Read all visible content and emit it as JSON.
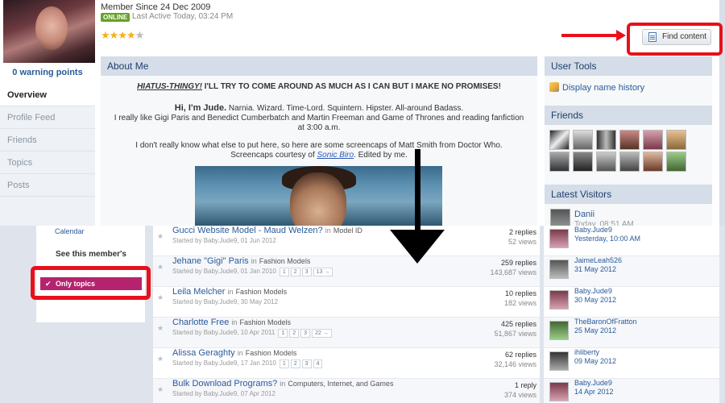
{
  "profile": {
    "member_since": "Member Since 24 Dec 2009",
    "online_badge": "ONLINE",
    "last_active": "Last Active Today, 03:24 PM",
    "warning_points": "0 warning points",
    "rating_stars": 4,
    "find_content_label": "Find content"
  },
  "nav": {
    "items": [
      "Overview",
      "Profile Feed",
      "Friends",
      "Topics",
      "Posts"
    ]
  },
  "about": {
    "title": "About Me",
    "hiatus_link": "HIATUS-THINGY!",
    "hiatus_text": " I'LL TRY TO COME AROUND AS MUCH AS I CAN BUT I MAKE NO PROMISES!",
    "hi_heading": "Hi, I'm Jude.",
    "hi_text": " Narnia. Wizard. Time-Lord. Squintern. Hipster. All-around Badass.",
    "paragraph_1": "I really like Gigi Paris and Benedict Cumberbatch and Martin Freeman and Game of Thrones and reading fanfiction at 3:00 a.m.",
    "paragraph_2": "I don't really know what else to put here, so here are some screencaps of Matt Smith from Doctor Who.",
    "screencaps_prefix": "Screencaps courtesy of ",
    "screencaps_link": "Sonic Biro",
    "screencaps_suffix": ". Edited by me."
  },
  "user_tools": {
    "title": "User Tools",
    "display_name_history": "Display name history"
  },
  "friends": {
    "title": "Friends"
  },
  "latest_visitors": {
    "title": "Latest Visitors",
    "name": "Danii",
    "time": "Today, 08:51 AM"
  },
  "left_panel": {
    "calendar": "Calendar",
    "see_member": "See this member's",
    "only_topics": "Only topics"
  },
  "topics": [
    {
      "title": "Gucci Website Model - Maud Welzen?",
      "in": "in",
      "forum": "Model ID",
      "meta": "Started by Baby.Jude9, 01 Jun 2012",
      "pages": [],
      "replies": "2 replies",
      "views": "52 views",
      "last_user": "Baby.Jude9",
      "last_date": "Yesterday, 10:00 AM"
    },
    {
      "title": "Jehane \"Gigi\" Paris",
      "in": "in",
      "forum": "Fashion Models",
      "meta": "Started by Baby.Jude9, 01 Jan 2010",
      "pages": [
        "1",
        "2",
        "3",
        "13 →"
      ],
      "replies": "259 replies",
      "views": "143,687 views",
      "last_user": "JaimeLeah526",
      "last_date": "31 May 2012"
    },
    {
      "title": "Leila Melcher",
      "in": "in",
      "forum": "Fashion Models",
      "meta": "Started by Baby.Jude9, 30 May 2012",
      "pages": [],
      "replies": "10 replies",
      "views": "182 views",
      "last_user": "Baby.Jude9",
      "last_date": "30 May 2012"
    },
    {
      "title": "Charlotte Free",
      "in": "in",
      "forum": "Fashion Models",
      "meta": "Started by Baby.Jude9, 10 Apr 2011",
      "pages": [
        "1",
        "2",
        "3",
        "22 →"
      ],
      "replies": "425 replies",
      "views": "51,867 views",
      "last_user": "TheBaronOfFratton",
      "last_date": "25 May 2012"
    },
    {
      "title": "Alissa Geraghty",
      "in": "in",
      "forum": "Fashion Models",
      "meta": "Started by Baby.Jude9, 17 Jan 2010",
      "pages": [
        "1",
        "2",
        "3",
        "4"
      ],
      "replies": "62 replies",
      "views": "32,146 views",
      "last_user": "ihliberty",
      "last_date": "09 May 2012"
    },
    {
      "title": "Bulk Download Programs?",
      "in": "in",
      "forum": "Computers, Internet, and Games",
      "meta": "Started by Baby.Jude9, 07 Apr 2012",
      "pages": [],
      "replies": "1 reply",
      "views": "374 views",
      "last_user": "Baby.Jude9",
      "last_date": "14 Apr 2012"
    }
  ],
  "colors": {
    "accent_red": "#e8101a",
    "link_blue": "#2a5a9a",
    "online_green": "#66a126",
    "only_topics_magenta": "#b5236e",
    "block_header": "#d4dde8"
  }
}
